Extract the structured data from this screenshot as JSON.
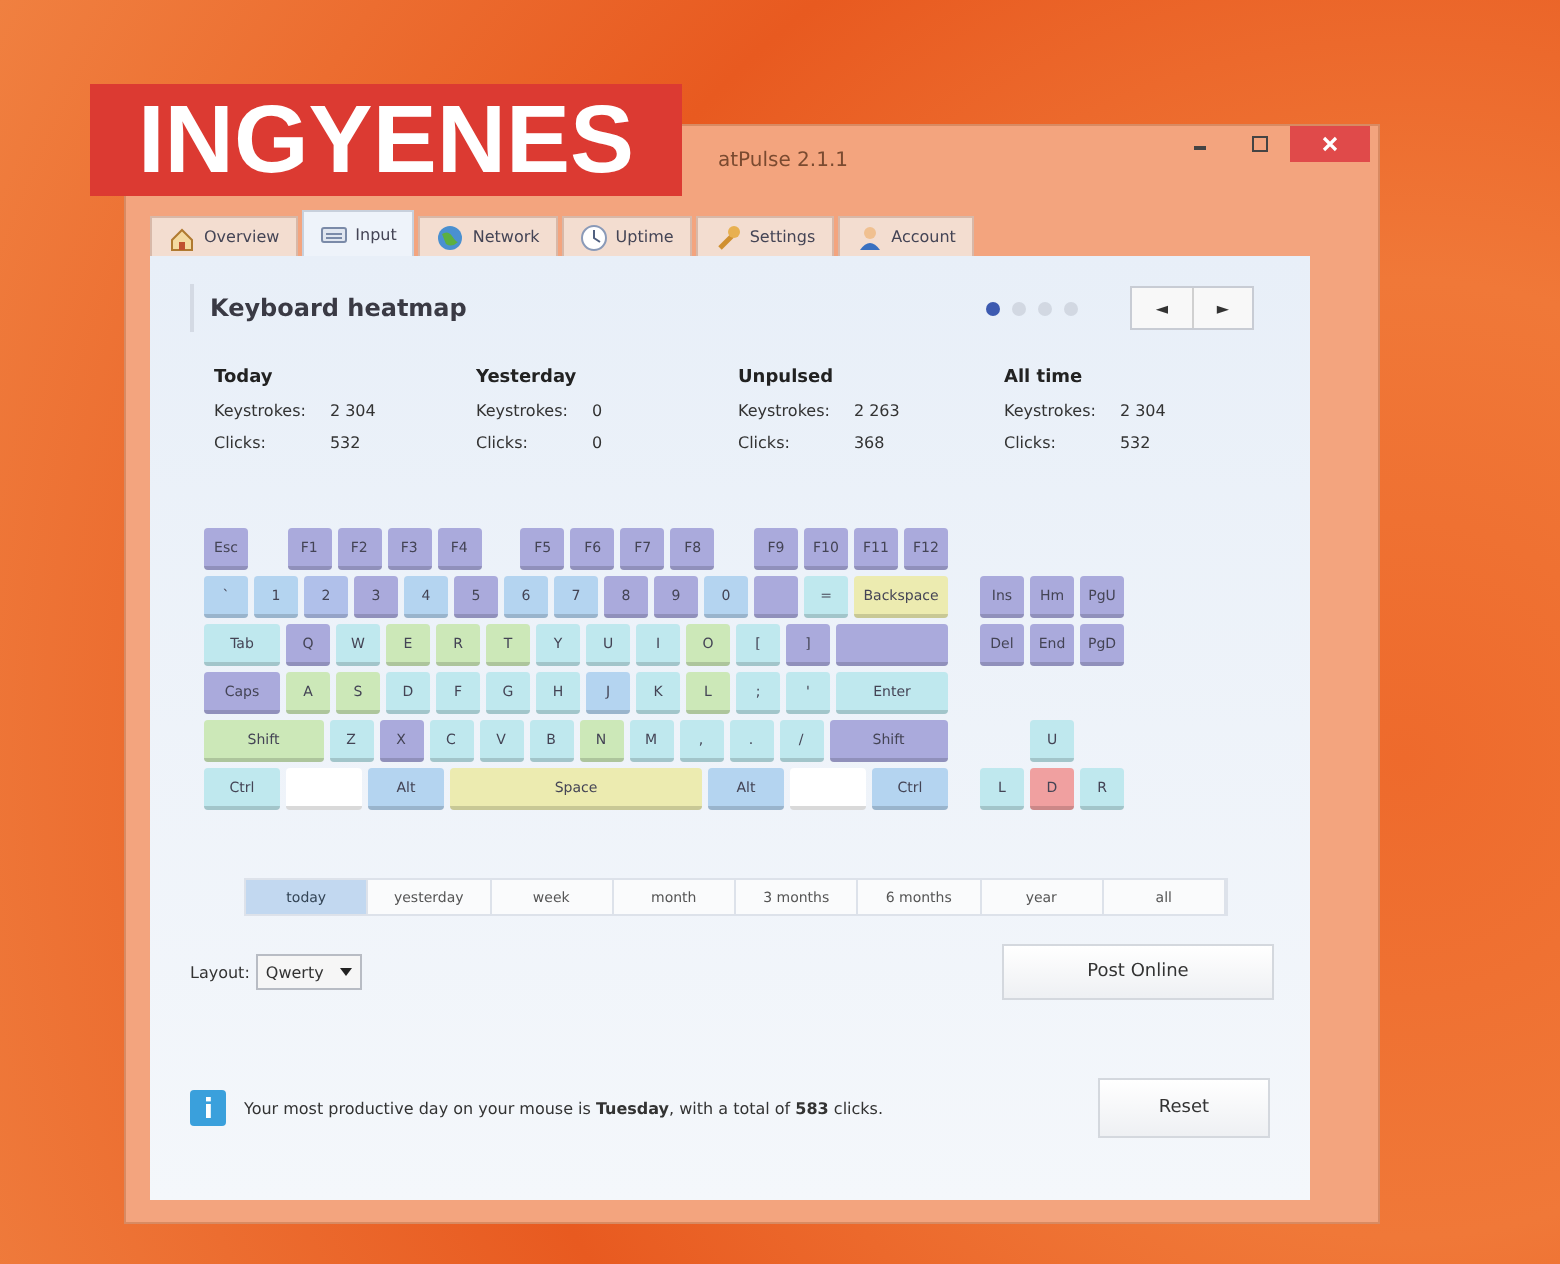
{
  "banner": {
    "text": "INGYENES"
  },
  "window": {
    "title": "atPulse 2.1.1"
  },
  "tabs": [
    {
      "label": "Overview",
      "selected": false
    },
    {
      "label": "Input",
      "selected": true
    },
    {
      "label": "Network",
      "selected": false
    },
    {
      "label": "Uptime",
      "selected": false
    },
    {
      "label": "Settings",
      "selected": false
    },
    {
      "label": "Account",
      "selected": false
    }
  ],
  "panel": {
    "title": "Keyboard heatmap",
    "pager": [
      {
        "selected": true
      },
      {
        "selected": false
      },
      {
        "selected": false
      },
      {
        "selected": false
      }
    ],
    "prev": "◄",
    "next": "►"
  },
  "stats": [
    {
      "title": "Today",
      "rows": [
        [
          "Keystrokes:",
          "2 304"
        ],
        [
          "Clicks:",
          "532"
        ]
      ]
    },
    {
      "title": "Yesterday",
      "rows": [
        [
          "Keystrokes:",
          "0"
        ],
        [
          "Clicks:",
          "0"
        ]
      ]
    },
    {
      "title": "Unpulsed",
      "rows": [
        [
          "Keystrokes:",
          "2 263"
        ],
        [
          "Clicks:",
          "368"
        ]
      ]
    },
    {
      "title": "All time",
      "rows": [
        [
          "Keystrokes:",
          "2 304"
        ],
        [
          "Clicks:",
          "532"
        ]
      ]
    }
  ],
  "keyboard": {
    "rows": [
      [
        [
          {
            "label": "Esc",
            "kind": "key",
            "color": "#aaaadc"
          }
        ],
        [
          {
            "label": "F1",
            "kind": "key",
            "color": "#aaaadc"
          },
          {
            "label": "F2",
            "kind": "key",
            "color": "#aaaadc"
          },
          {
            "label": "F3",
            "kind": "key",
            "color": "#aaaadc"
          },
          {
            "label": "F4",
            "kind": "key",
            "color": "#aaaadc"
          }
        ],
        [
          {
            "label": "F5",
            "kind": "key",
            "color": "#aaaadc"
          },
          {
            "label": "F6",
            "kind": "key",
            "color": "#aaaadc"
          },
          {
            "label": "F7",
            "kind": "key",
            "color": "#aaaadc"
          },
          {
            "label": "F8",
            "kind": "key",
            "color": "#aaaadc"
          }
        ],
        [
          {
            "label": "F9",
            "kind": "key",
            "color": "#aaaadc"
          },
          {
            "label": "F10",
            "kind": "key",
            "color": "#aaaadc"
          },
          {
            "label": "F11",
            "kind": "key",
            "color": "#aaaadc"
          },
          {
            "label": "F12",
            "kind": "key",
            "color": "#aaaadc"
          }
        ]
      ],
      [
        [
          {
            "label": "`",
            "kind": "key",
            "color": "#b4d4f0"
          },
          {
            "label": "1",
            "kind": "key",
            "color": "#b4d4f0"
          },
          {
            "label": "2",
            "kind": "key",
            "color": "#b0c0ea"
          },
          {
            "label": "3",
            "kind": "key",
            "color": "#aaaadc"
          },
          {
            "label": "4",
            "kind": "key",
            "color": "#b4d4f0"
          },
          {
            "label": "5",
            "kind": "key",
            "color": "#aaaadc"
          },
          {
            "label": "6",
            "kind": "key",
            "color": "#b4d4f0"
          },
          {
            "label": "7",
            "kind": "key",
            "color": "#b4d4f0"
          },
          {
            "label": "8",
            "kind": "key",
            "color": "#aaaadc"
          },
          {
            "label": "9",
            "kind": "key",
            "color": "#aaaadc"
          },
          {
            "label": "0",
            "kind": "key",
            "color": "#b4d4f0"
          },
          {
            "kind": "key",
            "color": "#aaaadc"
          },
          {
            "label": "=",
            "kind": "key",
            "color": "#bfe8ee"
          },
          {
            "label": "Backspace",
            "kind": "wide",
            "color": "#ecebb0"
          }
        ]
      ],
      [
        [
          {
            "label": "Tab",
            "kind": "mod",
            "color": "#bfe8ee"
          },
          {
            "label": "Q",
            "kind": "key",
            "color": "#aaaadc"
          },
          {
            "label": "W",
            "kind": "key",
            "color": "#bfe8ee"
          },
          {
            "label": "E",
            "kind": "key",
            "color": "#cce8b8"
          },
          {
            "label": "R",
            "kind": "key",
            "color": "#cce8b8"
          },
          {
            "label": "T",
            "kind": "key",
            "color": "#cce8b8"
          },
          {
            "label": "Y",
            "kind": "key",
            "color": "#bfe8ee"
          },
          {
            "label": "U",
            "kind": "key",
            "color": "#bfe8ee"
          },
          {
            "label": "I",
            "kind": "key",
            "color": "#bfe8ee"
          },
          {
            "label": "O",
            "kind": "key",
            "color": "#cce8b8"
          },
          {
            "label": "[",
            "kind": "key",
            "color": "#bfe8ee"
          },
          {
            "label": "]",
            "kind": "key",
            "color": "#aaaadc"
          },
          {
            "kind": "wide",
            "color": "#aaaadc"
          }
        ]
      ],
      [
        [
          {
            "label": "Caps",
            "kind": "mod",
            "color": "#aaaadc"
          },
          {
            "label": "A",
            "kind": "key",
            "color": "#cce8b8"
          },
          {
            "label": "S",
            "kind": "key",
            "color": "#cce8b8"
          },
          {
            "label": "D",
            "kind": "key",
            "color": "#bfe8ee"
          },
          {
            "label": "F",
            "kind": "key",
            "color": "#bfe8ee"
          },
          {
            "label": "G",
            "kind": "key",
            "color": "#bfe8ee"
          },
          {
            "label": "H",
            "kind": "key",
            "color": "#bfe8ee"
          },
          {
            "label": "J",
            "kind": "key",
            "color": "#b4d4f0"
          },
          {
            "label": "K",
            "kind": "key",
            "color": "#bfe8ee"
          },
          {
            "label": "L",
            "kind": "key",
            "color": "#cce8b8"
          },
          {
            "label": ";",
            "kind": "key",
            "color": "#bfe8ee"
          },
          {
            "label": "'",
            "kind": "key",
            "color": "#bfe8ee"
          },
          {
            "label": "Enter",
            "kind": "wide",
            "color": "#bfe8ee"
          }
        ]
      ],
      [
        [
          {
            "label": "Shift",
            "kind": "wide",
            "color": "#cce8b8"
          },
          {
            "label": "Z",
            "kind": "key",
            "color": "#bfe8ee"
          },
          {
            "label": "X",
            "kind": "key",
            "color": "#aaaadc"
          },
          {
            "label": "C",
            "kind": "key",
            "color": "#bfe8ee"
          },
          {
            "label": "V",
            "kind": "key",
            "color": "#bfe8ee"
          },
          {
            "label": "B",
            "kind": "key",
            "color": "#bfe8ee"
          },
          {
            "label": "N",
            "kind": "key",
            "color": "#cce8b8"
          },
          {
            "label": "M",
            "kind": "key",
            "color": "#bfe8ee"
          },
          {
            "label": ",",
            "kind": "key",
            "color": "#bfe8ee"
          },
          {
            "label": ".",
            "kind": "key",
            "color": "#bfe8ee"
          },
          {
            "label": "/",
            "kind": "key",
            "color": "#bfe8ee"
          },
          {
            "label": "Shift",
            "kind": "wide",
            "color": "#aaaadc"
          }
        ]
      ],
      [
        [
          {
            "label": "Ctrl",
            "kind": "mod",
            "color": "#bfe8ee"
          },
          {
            "kind": "mod",
            "color": "#ffffff"
          },
          {
            "label": "Alt",
            "kind": "mod",
            "color": "#b4d4f0"
          },
          {
            "label": "Space",
            "kind": "space",
            "color": "#ecebb0"
          },
          {
            "label": "Alt",
            "kind": "mod",
            "color": "#b4d4f0"
          },
          {
            "kind": "mod",
            "color": "#ffffff"
          },
          {
            "label": "Ctrl",
            "kind": "mod",
            "color": "#b4d4f0"
          }
        ]
      ]
    ],
    "edit_keys": [
      [
        {
          "label": "Ins",
          "color": "#aaaadc"
        },
        {
          "label": "Hm",
          "color": "#aaaadc"
        },
        {
          "label": "PgU",
          "color": "#aaaadc"
        }
      ],
      [
        {
          "label": "Del",
          "color": "#aaaadc"
        },
        {
          "label": "End",
          "color": "#aaaadc"
        },
        {
          "label": "PgD",
          "color": "#aaaadc"
        }
      ]
    ],
    "arrow_keys": [
      [
        {
          "label": "U",
          "color": "#bfe8ee"
        }
      ],
      [
        {
          "label": "L",
          "color": "#bfe8ee"
        },
        {
          "label": "D",
          "color": "#f0a0a0"
        },
        {
          "label": "R",
          "color": "#bfe8ee"
        }
      ]
    ]
  },
  "range_tabs": [
    {
      "label": "today",
      "selected": true
    },
    {
      "label": "yesterday",
      "selected": false
    },
    {
      "label": "week",
      "selected": false
    },
    {
      "label": "month",
      "selected": false
    },
    {
      "label": "3 months",
      "selected": false
    },
    {
      "label": "6 months",
      "selected": false
    },
    {
      "label": "year",
      "selected": false
    },
    {
      "label": "all",
      "selected": false
    }
  ],
  "layout": {
    "label": "Layout:",
    "value": "Qwerty"
  },
  "post_button": "Post Online",
  "info": {
    "text": "Your most productive day on your mouse is **Tuesday**, with a total of **583** clicks.",
    "button": "Reset"
  }
}
